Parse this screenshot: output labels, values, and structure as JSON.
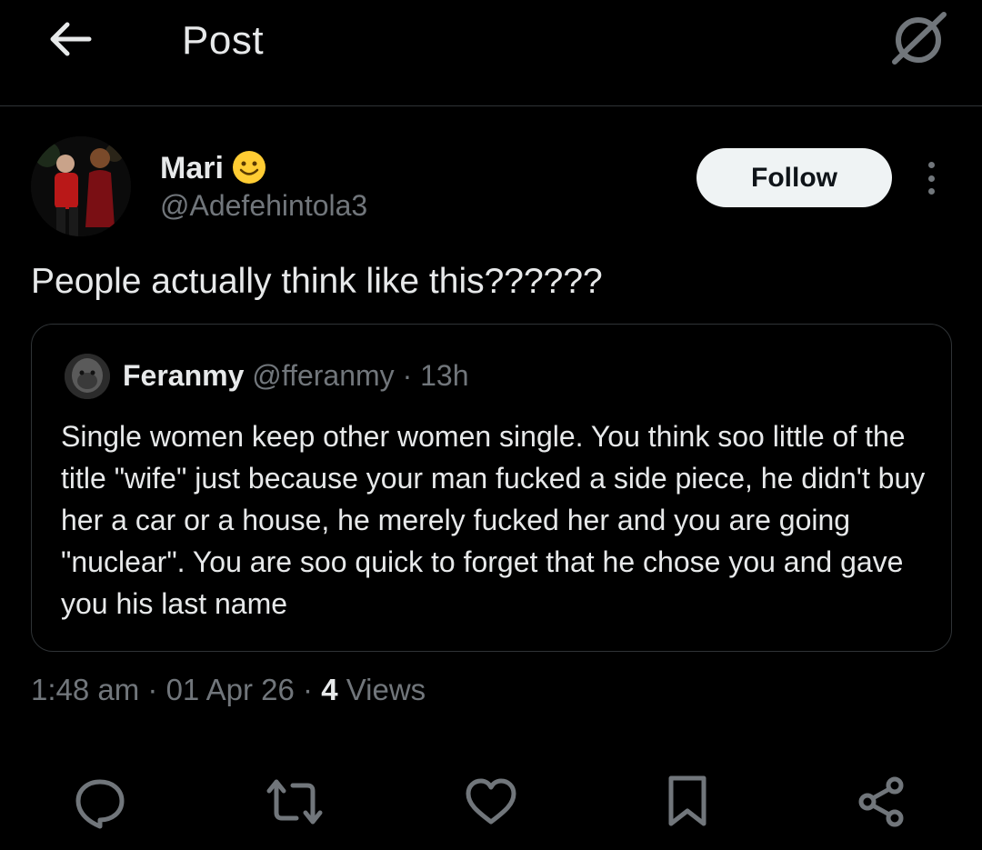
{
  "header": {
    "title": "Post",
    "back_icon": "arrow-left-icon",
    "grok_icon": "grok-icon"
  },
  "author": {
    "display_name": "Mari",
    "emoji_icon": "smiling-face-icon",
    "handle": "@Adefehintola3",
    "follow_label": "Follow"
  },
  "post": {
    "text": "People actually think like this??????"
  },
  "quoted_post": {
    "name": "Feranmy",
    "handle": "@fferanmy",
    "separator": " · ",
    "time": "13h",
    "text": "Single women keep other women single. You think soo little of the title \"wife\" just because your man fucked a side piece, he didn't buy her a car or a house, he merely fucked her and you are going \"nuclear\". You are soo quick to forget that he chose you and gave you his last name"
  },
  "meta": {
    "time": "1:48 am",
    "sep1": " · ",
    "date": "01 Apr 26",
    "sep2": " · ",
    "views_count": "4",
    "views_label": " Views"
  },
  "actions": [
    "reply-icon",
    "repost-icon",
    "like-icon",
    "bookmark-icon",
    "share-icon"
  ],
  "colors": {
    "background": "#000000",
    "text": "#e7e9ea",
    "muted": "#71767b",
    "border": "#2f3336",
    "follow_bg": "#eff3f4"
  }
}
